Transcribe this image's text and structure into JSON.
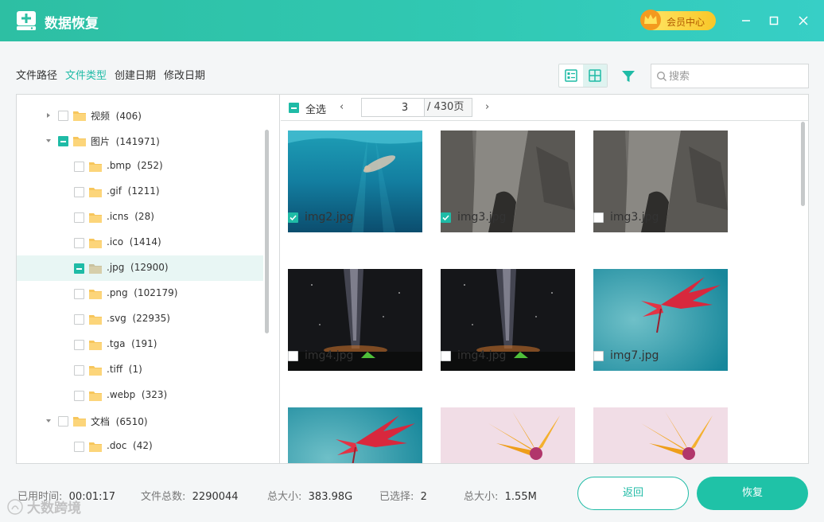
{
  "app": {
    "title": "数据恢复",
    "vip_label": "会员中心"
  },
  "tabs": [
    {
      "label": "文件路径",
      "active": false
    },
    {
      "label": "文件类型",
      "active": true
    },
    {
      "label": "创建日期",
      "active": false
    },
    {
      "label": "修改日期",
      "active": false
    }
  ],
  "search": {
    "placeholder": "搜索",
    "value": ""
  },
  "tree": {
    "items": [
      {
        "label": "视频",
        "count": "(406)",
        "expandable": true,
        "expanded": false,
        "state": "unchecked"
      },
      {
        "label": "图片",
        "count": "(141971)",
        "expandable": true,
        "expanded": true,
        "state": "mixed"
      },
      {
        "label": ".bmp",
        "count": "(252)",
        "state": "unchecked"
      },
      {
        "label": ".gif",
        "count": "(1211)",
        "state": "unchecked"
      },
      {
        "label": ".icns",
        "count": "(28)",
        "state": "unchecked"
      },
      {
        "label": ".ico",
        "count": "(1414)",
        "state": "unchecked"
      },
      {
        "label": ".jpg",
        "count": "(12900)",
        "state": "mixed",
        "selected": true
      },
      {
        "label": ".png",
        "count": "(102179)",
        "state": "unchecked"
      },
      {
        "label": ".svg",
        "count": "(22935)",
        "state": "unchecked"
      },
      {
        "label": ".tga",
        "count": "(191)",
        "state": "unchecked"
      },
      {
        "label": ".tiff",
        "count": "(1)",
        "state": "unchecked"
      },
      {
        "label": ".webp",
        "count": "(323)",
        "state": "unchecked"
      },
      {
        "label": "文档",
        "count": "(6510)",
        "expandable": true,
        "expanded": true,
        "state": "unchecked"
      },
      {
        "label": ".doc",
        "count": "(42)",
        "state": "unchecked"
      }
    ]
  },
  "grid": {
    "select_all_label": "全选",
    "select_all_state": "mixed",
    "current_page": "3",
    "total_pages": "/ 430页",
    "prev": "‹",
    "next": "›",
    "items": [
      {
        "name": "img2.jpg",
        "checked": true,
        "image": "underwater-swimmer"
      },
      {
        "name": "img3.jpg",
        "checked": true,
        "image": "rock-cliff"
      },
      {
        "name": "img3.jpg",
        "checked": false,
        "image": "rock-cliff"
      },
      {
        "name": "img4.jpg",
        "checked": false,
        "image": "milky-way-tent"
      },
      {
        "name": "img4.jpg",
        "checked": false,
        "image": "milky-way-tent"
      },
      {
        "name": "img7.jpg",
        "checked": false,
        "image": "red-flower-teal"
      },
      {
        "name": "",
        "checked": false,
        "image": "red-flower-teal"
      },
      {
        "name": "",
        "checked": false,
        "image": "orange-flower-pink"
      },
      {
        "name": "",
        "checked": false,
        "image": "orange-flower-pink"
      }
    ]
  },
  "footer": {
    "elapsed_key": "已用时间:",
    "elapsed_val": "00:01:17",
    "total_files_key": "文件总数:",
    "total_files_val": "2290044",
    "total_size_key": "总大小:",
    "total_size_val": "383.98G",
    "selected_key": "已选择:",
    "selected_val": "2",
    "selected_size_key": "总大小:",
    "selected_size_val": "1.55M",
    "back_label": "返回",
    "recover_label": "恢复"
  },
  "watermark": "大数跨境",
  "colors": {
    "accent": "#1fbba6",
    "titlebar": "#31c9b4",
    "vip": "#f8c728"
  }
}
